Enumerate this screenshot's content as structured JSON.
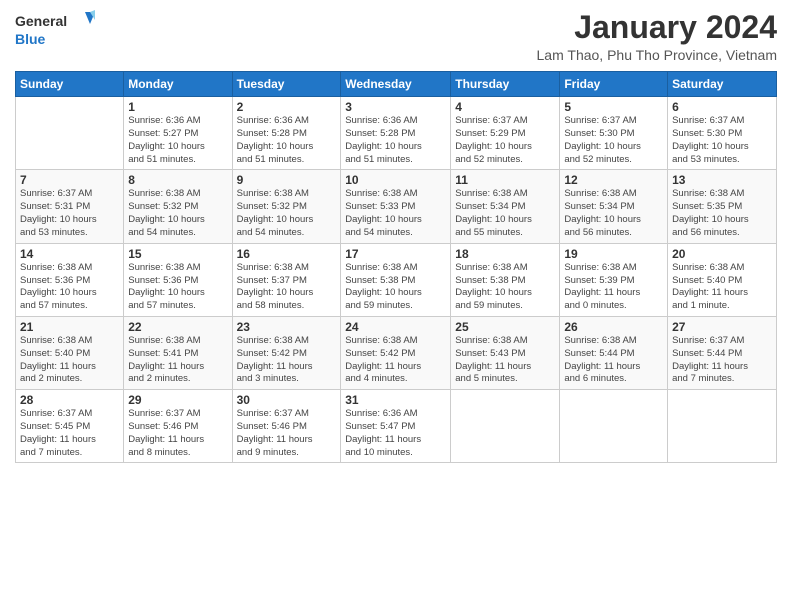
{
  "header": {
    "logo_general": "General",
    "logo_blue": "Blue",
    "month_title": "January 2024",
    "location": "Lam Thao, Phu Tho Province, Vietnam"
  },
  "days_of_week": [
    "Sunday",
    "Monday",
    "Tuesday",
    "Wednesday",
    "Thursday",
    "Friday",
    "Saturday"
  ],
  "weeks": [
    [
      {
        "day": "",
        "info": ""
      },
      {
        "day": "1",
        "info": "Sunrise: 6:36 AM\nSunset: 5:27 PM\nDaylight: 10 hours\nand 51 minutes."
      },
      {
        "day": "2",
        "info": "Sunrise: 6:36 AM\nSunset: 5:28 PM\nDaylight: 10 hours\nand 51 minutes."
      },
      {
        "day": "3",
        "info": "Sunrise: 6:36 AM\nSunset: 5:28 PM\nDaylight: 10 hours\nand 51 minutes."
      },
      {
        "day": "4",
        "info": "Sunrise: 6:37 AM\nSunset: 5:29 PM\nDaylight: 10 hours\nand 52 minutes."
      },
      {
        "day": "5",
        "info": "Sunrise: 6:37 AM\nSunset: 5:30 PM\nDaylight: 10 hours\nand 52 minutes."
      },
      {
        "day": "6",
        "info": "Sunrise: 6:37 AM\nSunset: 5:30 PM\nDaylight: 10 hours\nand 53 minutes."
      }
    ],
    [
      {
        "day": "7",
        "info": "Sunrise: 6:37 AM\nSunset: 5:31 PM\nDaylight: 10 hours\nand 53 minutes."
      },
      {
        "day": "8",
        "info": "Sunrise: 6:38 AM\nSunset: 5:32 PM\nDaylight: 10 hours\nand 54 minutes."
      },
      {
        "day": "9",
        "info": "Sunrise: 6:38 AM\nSunset: 5:32 PM\nDaylight: 10 hours\nand 54 minutes."
      },
      {
        "day": "10",
        "info": "Sunrise: 6:38 AM\nSunset: 5:33 PM\nDaylight: 10 hours\nand 54 minutes."
      },
      {
        "day": "11",
        "info": "Sunrise: 6:38 AM\nSunset: 5:34 PM\nDaylight: 10 hours\nand 55 minutes."
      },
      {
        "day": "12",
        "info": "Sunrise: 6:38 AM\nSunset: 5:34 PM\nDaylight: 10 hours\nand 56 minutes."
      },
      {
        "day": "13",
        "info": "Sunrise: 6:38 AM\nSunset: 5:35 PM\nDaylight: 10 hours\nand 56 minutes."
      }
    ],
    [
      {
        "day": "14",
        "info": "Sunrise: 6:38 AM\nSunset: 5:36 PM\nDaylight: 10 hours\nand 57 minutes."
      },
      {
        "day": "15",
        "info": "Sunrise: 6:38 AM\nSunset: 5:36 PM\nDaylight: 10 hours\nand 57 minutes."
      },
      {
        "day": "16",
        "info": "Sunrise: 6:38 AM\nSunset: 5:37 PM\nDaylight: 10 hours\nand 58 minutes."
      },
      {
        "day": "17",
        "info": "Sunrise: 6:38 AM\nSunset: 5:38 PM\nDaylight: 10 hours\nand 59 minutes."
      },
      {
        "day": "18",
        "info": "Sunrise: 6:38 AM\nSunset: 5:38 PM\nDaylight: 10 hours\nand 59 minutes."
      },
      {
        "day": "19",
        "info": "Sunrise: 6:38 AM\nSunset: 5:39 PM\nDaylight: 11 hours\nand 0 minutes."
      },
      {
        "day": "20",
        "info": "Sunrise: 6:38 AM\nSunset: 5:40 PM\nDaylight: 11 hours\nand 1 minute."
      }
    ],
    [
      {
        "day": "21",
        "info": "Sunrise: 6:38 AM\nSunset: 5:40 PM\nDaylight: 11 hours\nand 2 minutes."
      },
      {
        "day": "22",
        "info": "Sunrise: 6:38 AM\nSunset: 5:41 PM\nDaylight: 11 hours\nand 2 minutes."
      },
      {
        "day": "23",
        "info": "Sunrise: 6:38 AM\nSunset: 5:42 PM\nDaylight: 11 hours\nand 3 minutes."
      },
      {
        "day": "24",
        "info": "Sunrise: 6:38 AM\nSunset: 5:42 PM\nDaylight: 11 hours\nand 4 minutes."
      },
      {
        "day": "25",
        "info": "Sunrise: 6:38 AM\nSunset: 5:43 PM\nDaylight: 11 hours\nand 5 minutes."
      },
      {
        "day": "26",
        "info": "Sunrise: 6:38 AM\nSunset: 5:44 PM\nDaylight: 11 hours\nand 6 minutes."
      },
      {
        "day": "27",
        "info": "Sunrise: 6:37 AM\nSunset: 5:44 PM\nDaylight: 11 hours\nand 7 minutes."
      }
    ],
    [
      {
        "day": "28",
        "info": "Sunrise: 6:37 AM\nSunset: 5:45 PM\nDaylight: 11 hours\nand 7 minutes."
      },
      {
        "day": "29",
        "info": "Sunrise: 6:37 AM\nSunset: 5:46 PM\nDaylight: 11 hours\nand 8 minutes."
      },
      {
        "day": "30",
        "info": "Sunrise: 6:37 AM\nSunset: 5:46 PM\nDaylight: 11 hours\nand 9 minutes."
      },
      {
        "day": "31",
        "info": "Sunrise: 6:36 AM\nSunset: 5:47 PM\nDaylight: 11 hours\nand 10 minutes."
      },
      {
        "day": "",
        "info": ""
      },
      {
        "day": "",
        "info": ""
      },
      {
        "day": "",
        "info": ""
      }
    ]
  ]
}
